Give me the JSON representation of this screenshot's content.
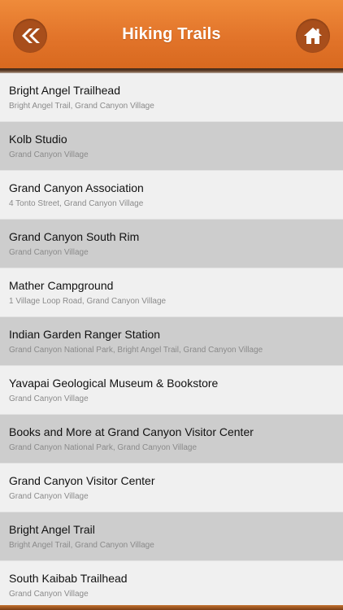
{
  "header": {
    "title": "Hiking Trails",
    "back_icon": "double-chevron-left-icon",
    "home_icon": "home-icon"
  },
  "colors": {
    "header_orange": "#e2742a",
    "button_brown": "#a84e1b",
    "row_light": "#f0f0f0",
    "row_dark": "#cdcdcd"
  },
  "trails": [
    {
      "name": "Bright Angel Trailhead",
      "address": "Bright Angel Trail, Grand Canyon Village"
    },
    {
      "name": "Kolb Studio",
      "address": "Grand Canyon Village"
    },
    {
      "name": "Grand Canyon Association",
      "address": "4 Tonto Street, Grand Canyon Village"
    },
    {
      "name": "Grand Canyon South Rim",
      "address": "Grand Canyon Village"
    },
    {
      "name": "Mather Campground",
      "address": "1 Village Loop Road, Grand Canyon Village"
    },
    {
      "name": "Indian Garden Ranger Station",
      "address": "Grand Canyon National Park, Bright Angel Trail, Grand Canyon Village"
    },
    {
      "name": "Yavapai Geological Museum & Bookstore",
      "address": "Grand Canyon Village"
    },
    {
      "name": "Books and More at Grand Canyon Visitor Center",
      "address": "Grand Canyon National Park, Grand Canyon Village"
    },
    {
      "name": "Grand Canyon Visitor Center",
      "address": "Grand Canyon Village"
    },
    {
      "name": "Bright Angel Trail",
      "address": "Bright Angel Trail, Grand Canyon Village"
    },
    {
      "name": "South Kaibab Trailhead",
      "address": "Grand Canyon Village"
    }
  ]
}
